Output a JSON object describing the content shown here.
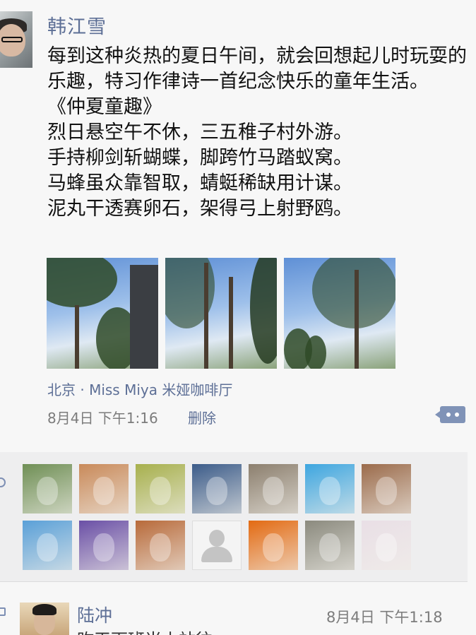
{
  "post": {
    "author": "韩江雪",
    "text_intro": "每到这种炎热的夏日午间，就会回想起儿时玩耍的乐趣，特习作律诗一首纪念快乐的童年生活。",
    "poem_title": "《仲夏童趣》",
    "poem_lines": [
      "烈日悬空午不休，三五稚子村外游。",
      "手持柳剑斩蝴蝶，脚跨竹马踏蚁窝。",
      "马蜂虽众靠智取，蜻蜓稀缺用计谋。",
      "泥丸干透赛卵石，架得弓上射野鸥。"
    ],
    "photo_icons": [
      "trees-sky-photo",
      "trees-sky-photo",
      "trees-sky-photo"
    ],
    "location": "北京 · Miss Miya 米娅咖啡厅",
    "time": "8月4日 下午1:16",
    "delete_label": "删除"
  },
  "likes": {
    "icon": "heart-icon",
    "avatar_count_rows": 2,
    "avatars": [
      {
        "icon": "garden-girl-photo",
        "color": "#6f8f55"
      },
      {
        "icon": "baby-face-photo",
        "color": "#c98a5a"
      },
      {
        "icon": "sunflower-cat-photo",
        "color": "#a7b04d"
      },
      {
        "icon": "water-reflection-photo",
        "color": "#3c5c8a"
      },
      {
        "icon": "cat-photo",
        "color": "#8c7f6e"
      },
      {
        "icon": "cartoon-girl-photo",
        "color": "#3ea6e0"
      },
      {
        "icon": "man-portrait-photo",
        "color": "#9b6b4b"
      },
      {
        "icon": "lake-tree-photo",
        "color": "#5aa0d8"
      },
      {
        "icon": "carnival-photo",
        "color": "#6a4fa6"
      },
      {
        "icon": "autumn-forest-photo",
        "color": "#b86a3a"
      },
      {
        "icon": "default-user-icon",
        "color": "#d0d0d0"
      },
      {
        "icon": "orange-eye-photo",
        "color": "#e36a12"
      },
      {
        "icon": "stones-photo",
        "color": "#8b8a7e"
      },
      {
        "icon": "child-hood-photo",
        "color": "#e9dfe6"
      }
    ]
  },
  "comment": {
    "author": "陆冲",
    "time": "8月4日 下午1:18",
    "text": "昨天下班当小站往"
  }
}
